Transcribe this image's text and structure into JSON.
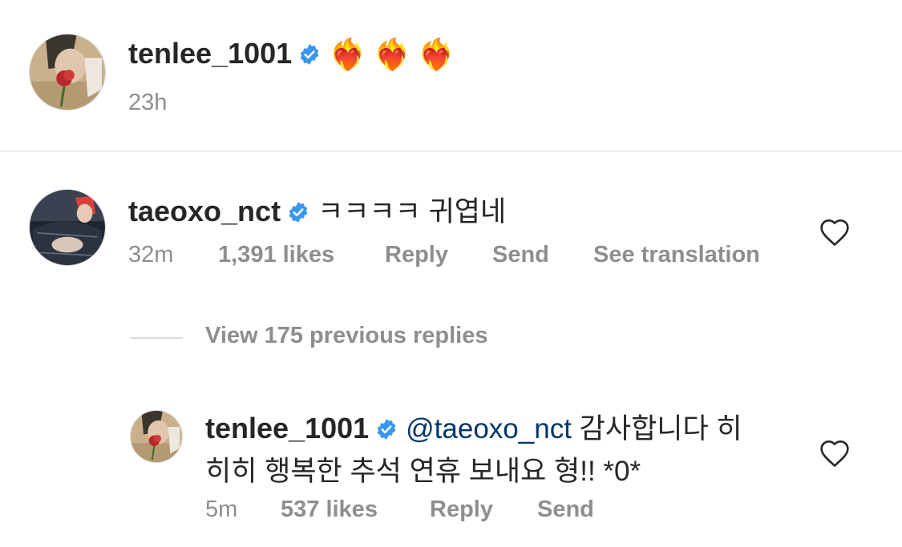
{
  "post": {
    "username": "tenlee_1001",
    "caption_emoji": "❤️‍🔥❤️‍🔥❤️‍🔥",
    "time": "23h"
  },
  "comment": {
    "username": "taeoxo_nct",
    "text": "ㅋㅋㅋㅋ 귀엽네",
    "time": "32m",
    "likes": "1,391 likes",
    "reply_label": "Reply",
    "send_label": "Send",
    "translate_label": "See translation"
  },
  "replies": {
    "view_label": "View 175 previous replies"
  },
  "reply": {
    "username": "tenlee_1001",
    "mention": "@taeoxo_nct",
    "text_line1": "감사합니다 히",
    "text_line2": "히히 행복한 추석 연휴 보내요 형!! *0*",
    "time": "5m",
    "likes": "537 likes",
    "reply_label": "Reply",
    "send_label": "Send"
  },
  "colors": {
    "verified": "#3897f0",
    "meta_gray": "#8e8e8e",
    "mention_blue": "#00376b"
  },
  "icons": {
    "verified": "verified-badge-icon",
    "like": "heart-outline-icon"
  }
}
